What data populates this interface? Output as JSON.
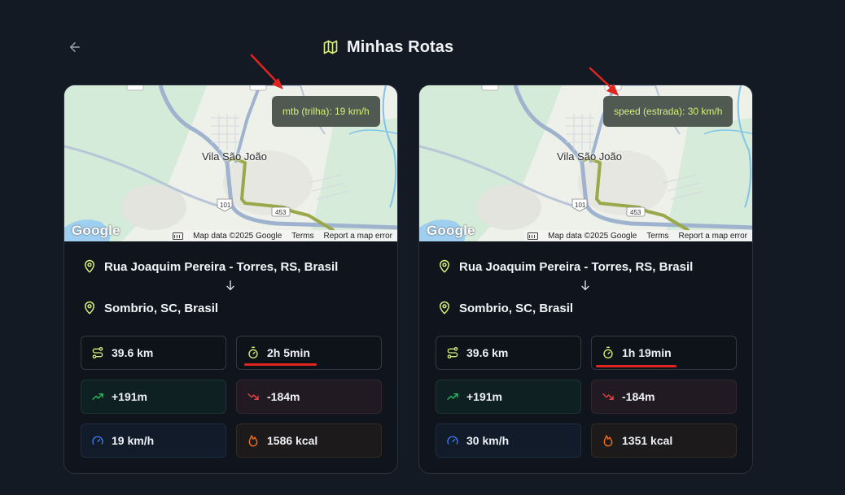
{
  "header": {
    "back_icon": "arrow-left-icon",
    "title_icon": "map-icon",
    "title": "Minhas Rotas"
  },
  "colors": {
    "background": "#141a24",
    "card": "#10151d",
    "accent": "#d6ef7a",
    "route": "#9aa84a",
    "elevation_up": "#22c55e",
    "elevation_down": "#ef4444",
    "speed": "#3b82f6",
    "calories": "#f97316",
    "annotation": "#e0241f"
  },
  "map": {
    "place_label": "Vila São João",
    "road_labels": [
      "101",
      "453",
      "101",
      "453"
    ],
    "google_logo": "Google",
    "attribution": "Map data ©2025 Google",
    "terms": "Terms",
    "report": "Report a map error"
  },
  "routes": [
    {
      "badge": "mtb (trilha): 19 km/h",
      "origin": "Rua Joaquim Pereira - Torres, RS, Brasil",
      "destination": "Sombrio, SC, Brasil",
      "distance": "39.6 km",
      "duration": "2h 5min",
      "elevation_gain": "+191m",
      "elevation_loss": "-184m",
      "speed": "19 km/h",
      "calories": "1586 kcal"
    },
    {
      "badge": "speed (estrada): 30 km/h",
      "origin": "Rua Joaquim Pereira - Torres, RS, Brasil",
      "destination": "Sombrio, SC, Brasil",
      "distance": "39.6 km",
      "duration": "1h 19min",
      "elevation_gain": "+191m",
      "elevation_loss": "-184m",
      "speed": "30 km/h",
      "calories": "1351 kcal"
    }
  ]
}
